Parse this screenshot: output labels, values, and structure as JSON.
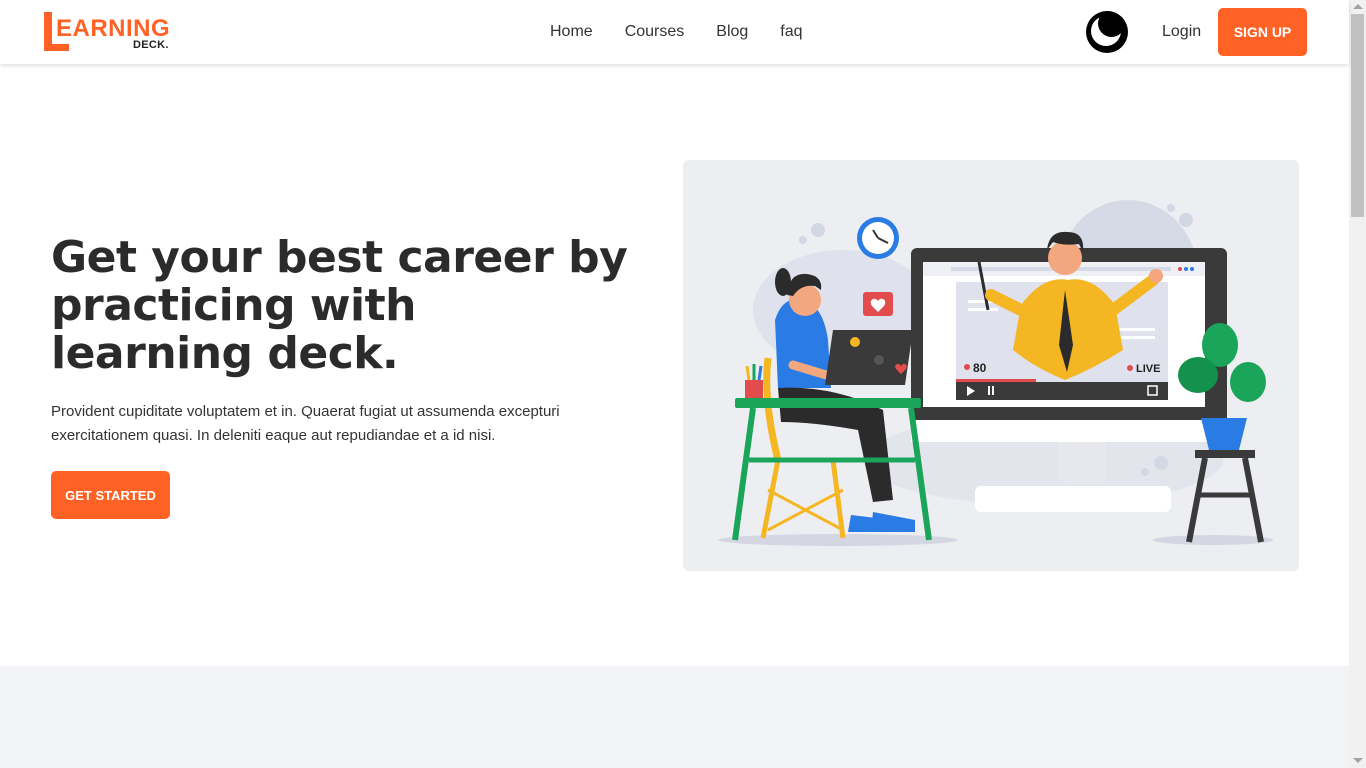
{
  "brand": {
    "logo_word": "EARNING",
    "logo_sub": "DECK.",
    "accent": "#ff6224"
  },
  "nav": {
    "links": [
      "Home",
      "Courses",
      "Blog",
      "faq"
    ],
    "theme_toggle_icon": "moon-icon",
    "login_label": "Login",
    "signup_label": "SIGN UP"
  },
  "hero": {
    "title": "Get your best career by practicing with learning deck.",
    "description": "Provident cupiditate voluptatem et in. Quaerat fugiat ut assumenda excepturi exercitationem quasi. In deleniti eaque aut repudiandae et a id nisi.",
    "cta_label": "GET STARTED"
  },
  "illustration": {
    "viewer_count": "80",
    "live_label": "LIVE"
  }
}
